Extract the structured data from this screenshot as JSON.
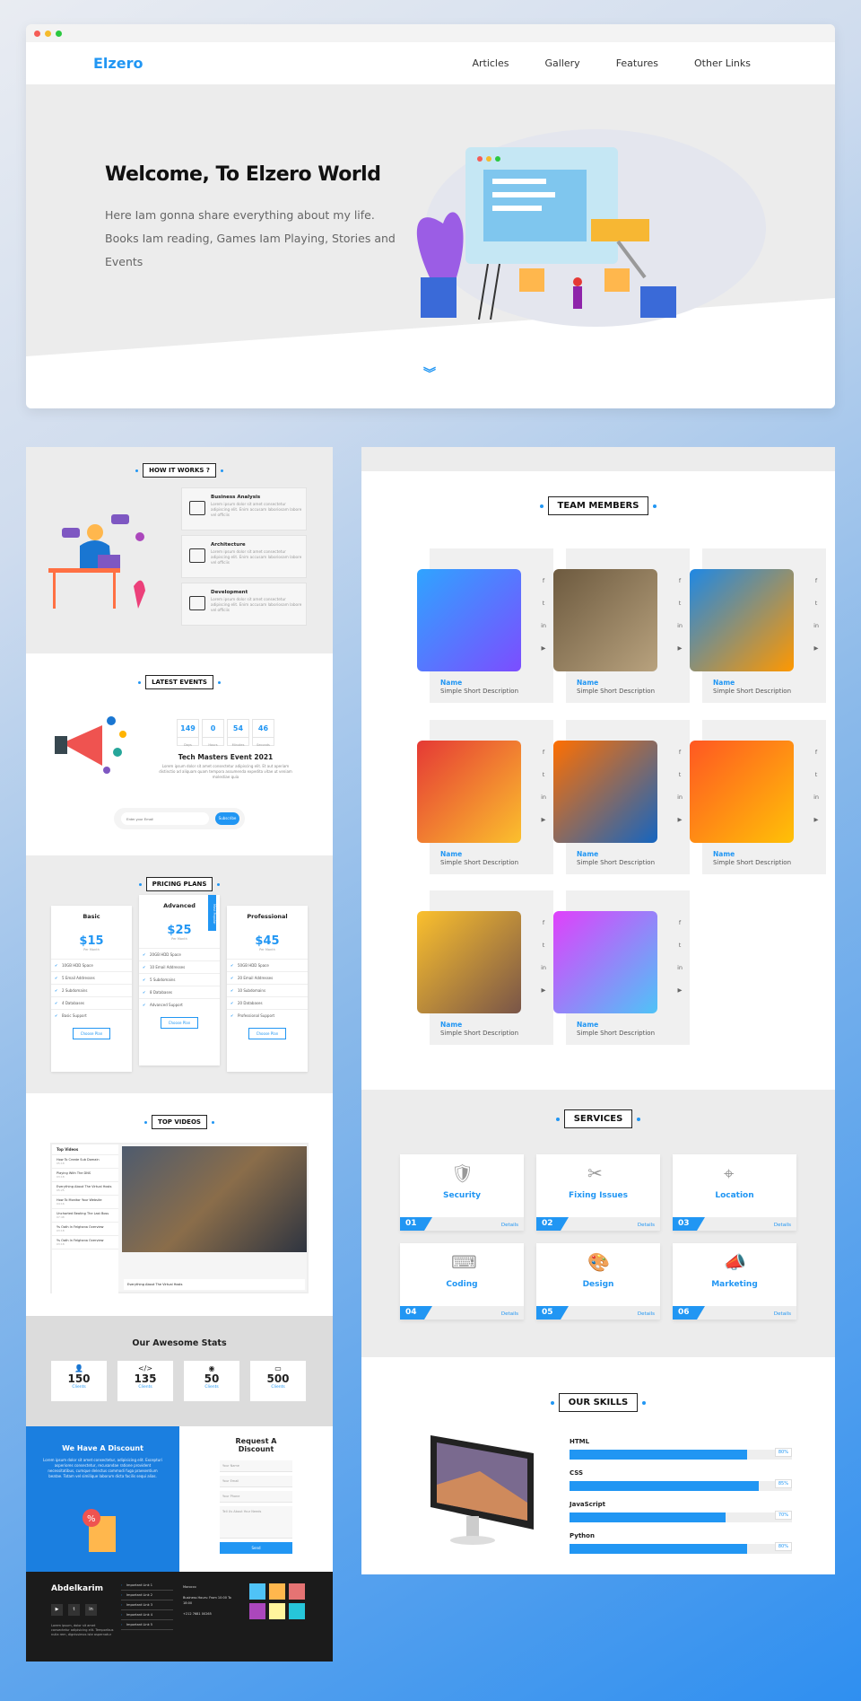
{
  "header": {
    "logo": "Elzero",
    "nav": [
      "Articles",
      "Gallery",
      "Features",
      "Other Links"
    ]
  },
  "landing": {
    "title": "Welcome, To Elzero World",
    "description": "Here Iam gonna share everything about my life. Books Iam reading, Games Iam Playing, Stories and Events"
  },
  "how_it_works": {
    "title": "HOW IT WORKS ?",
    "items": [
      {
        "title": "Business Analysis",
        "desc": "Lorem ipsum dolor sit amet consectetur adipiscing elit. Enim accusam laboriosam labore vel officiis"
      },
      {
        "title": "Architecture",
        "desc": "Lorem ipsum dolor sit amet consectetur adipiscing elit. Enim accusam laboriosam labore vel officiis"
      },
      {
        "title": "Development",
        "desc": "Lorem ipsum dolor sit amet consectetur adipiscing elit. Enim accusam laboriosam labore vel officiis"
      }
    ]
  },
  "events": {
    "title": "LATEST EVENTS",
    "countdown": [
      {
        "v": "149",
        "l": "Days"
      },
      {
        "v": "0",
        "l": "Hours"
      },
      {
        "v": "54",
        "l": "Minutes"
      },
      {
        "v": "46",
        "l": "Seconds"
      }
    ],
    "event_title": "Tech Masters Event 2021",
    "event_desc": "Lorem ipsum dolor sit amet consectetur adipiscing elit. Et aut aperiam distinctio ad aliquam quam tempora assumenda expedita vitae ut veniam molestiae quia",
    "email_placeholder": "Enter your Email",
    "subscribe": "Subscribe"
  },
  "pricing": {
    "title": "PRICING PLANS",
    "plans": [
      {
        "name": "Basic",
        "price": "$15",
        "per": "Per Month",
        "features": [
          "10GB HDD Space",
          "5 Email Addresses",
          "2 Subdomains",
          "4 Databases",
          "Basic Support"
        ],
        "button": "Choose Plan"
      },
      {
        "name": "Advanced",
        "price": "$25",
        "per": "Per Month",
        "features": [
          "20GB HDD Space",
          "10 Email Addresses",
          "5 Subdomains",
          "8 Databases",
          "Advanced Support"
        ],
        "button": "Choose Plan",
        "badge": "Most Popular"
      },
      {
        "name": "Professional",
        "price": "$45",
        "per": "Per Month",
        "features": [
          "50GB HDD Space",
          "20 Email Addresses",
          "10 Subdomains",
          "20 Databases",
          "Professional Support"
        ],
        "button": "Choose Plan"
      }
    ]
  },
  "videos": {
    "title": "TOP VIDEOS",
    "list_title": "Top Videos",
    "items": [
      {
        "t": "How To Create Sub Domain",
        "d": "05:18"
      },
      {
        "t": "Playing With The DNS",
        "d": "03:18"
      },
      {
        "t": "Everything About The Virtual Hosts",
        "d": "05:25"
      },
      {
        "t": "How To Monitor Your Website",
        "d": "04:16"
      },
      {
        "t": "Uncharted Beating The Last Boss",
        "d": "07:48"
      },
      {
        "t": "Ys Oath In Felghana Overview",
        "d": "03:18"
      },
      {
        "t": "Ys Oath In Felghana Overview",
        "d": "03:18"
      }
    ],
    "caption": "Everything About The Virtual Hosts"
  },
  "stats": {
    "title": "Our Awesome Stats",
    "items": [
      {
        "n": "150",
        "l": "Clients"
      },
      {
        "n": "135",
        "l": "Clients"
      },
      {
        "n": "50",
        "l": "Clients"
      },
      {
        "n": "500",
        "l": "Clients"
      }
    ]
  },
  "discount": {
    "left_title": "We Have A Discount",
    "left_desc": "Lorem ipsum dolor sit amet consectetur, adipisicing elit. Excepturi asperiores consectetur, recusandae ratione provident necessitatibus, cumque delectus commodi fuga praesentium beatae. Totam vel similique laborum dicta facilis sequi alias.",
    "right_title": "Request A Discount",
    "fields": [
      "Your Name",
      "Your Email",
      "Your Phone",
      "Tell Us About Your Needs"
    ],
    "send": "Send"
  },
  "footer": {
    "name": "Abdelkarim",
    "desc": "Lorem ipsum, dolor sit amet consectetur adipisicing elit. Temporibus nulla rem, dignissimos iste aspernatur",
    "links": [
      "Important Link 1",
      "Important Link 2",
      "Important Link 3",
      "Important Link 4",
      "Important Link 5"
    ],
    "address": "Morocco",
    "hours": "Business Hours: From 10:00 To 18:00",
    "phone": "+212 7681 00265"
  },
  "team": {
    "title": "TEAM MEMBERS",
    "members": [
      {
        "name": "Name",
        "desc": "Simple Short Description"
      },
      {
        "name": "Name",
        "desc": "Simple Short Description"
      },
      {
        "name": "Name",
        "desc": "Simple Short Description"
      },
      {
        "name": "Name",
        "desc": "Simple Short Description"
      },
      {
        "name": "Name",
        "desc": "Simple Short Description"
      },
      {
        "name": "Name",
        "desc": "Simple Short Description"
      },
      {
        "name": "Name",
        "desc": "Simple Short Description"
      },
      {
        "name": "Name",
        "desc": "Simple Short Description"
      }
    ]
  },
  "services": {
    "title": "SERVICES",
    "items": [
      {
        "name": "Security",
        "num": "01",
        "icon": "user-shield-icon",
        "details": "Details"
      },
      {
        "name": "Fixing Issues",
        "num": "02",
        "icon": "tools-icon",
        "details": "Details"
      },
      {
        "name": "Location",
        "num": "03",
        "icon": "map-icon",
        "details": "Details"
      },
      {
        "name": "Coding",
        "num": "04",
        "icon": "laptop-code-icon",
        "details": "Details"
      },
      {
        "name": "Design",
        "num": "05",
        "icon": "palette-icon",
        "details": "Details"
      },
      {
        "name": "Marketing",
        "num": "06",
        "icon": "bullhorn-icon",
        "details": "Details"
      }
    ]
  },
  "skills": {
    "title": "OUR SKILLS",
    "items": [
      {
        "name": "HTML",
        "pct": 80,
        "label": "80%"
      },
      {
        "name": "CSS",
        "pct": 85,
        "label": "85%"
      },
      {
        "name": "JavaScript",
        "pct": 70,
        "label": "70%"
      },
      {
        "name": "Python",
        "pct": 80,
        "label": "80%"
      }
    ]
  },
  "colors": {
    "accent": "#2196f3"
  }
}
